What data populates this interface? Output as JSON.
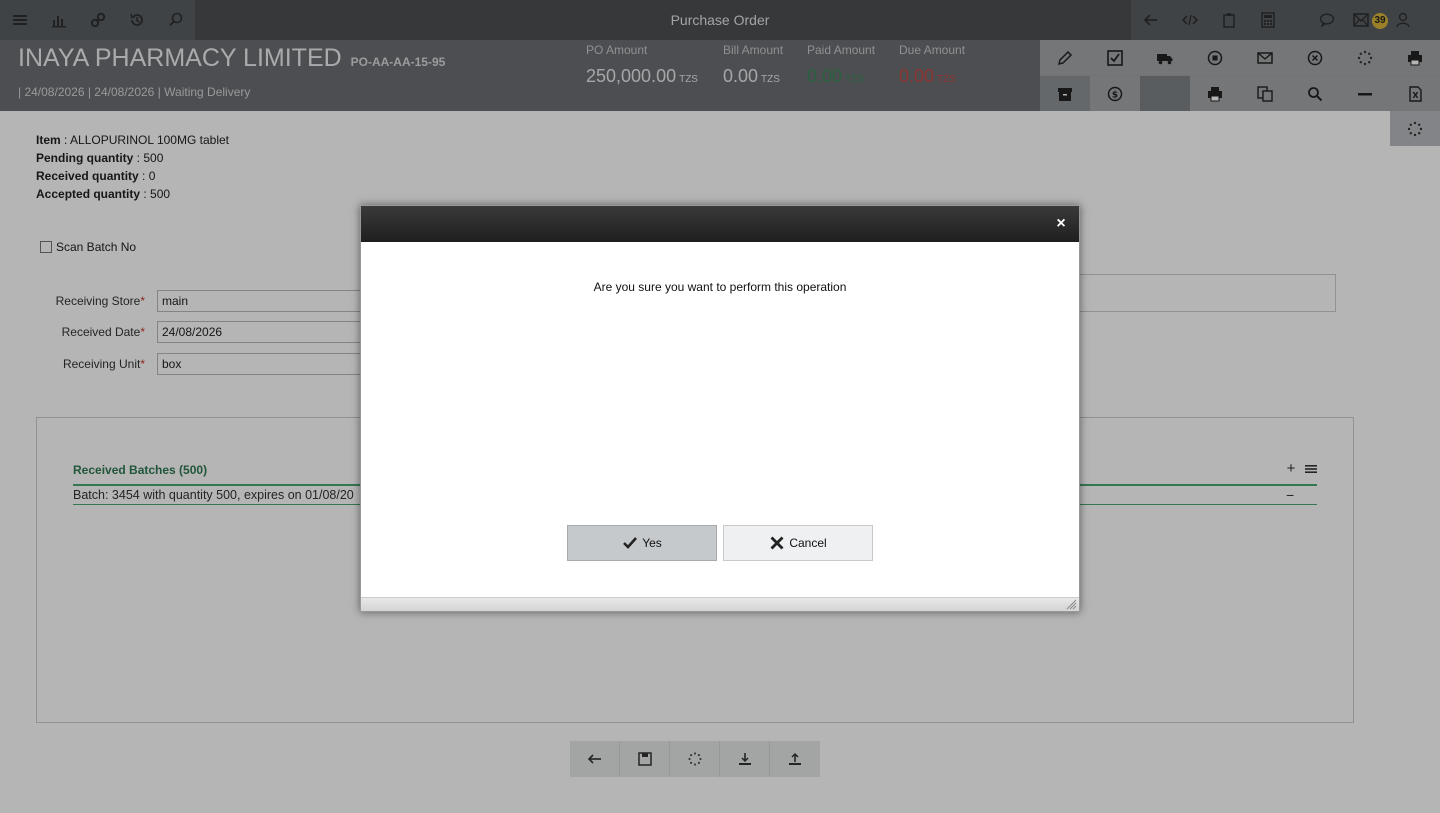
{
  "topbar": {
    "title": "Purchase Order",
    "left_icons": [
      "menu-icon",
      "bar-chart-icon",
      "link-icon",
      "history-icon",
      "search-icon"
    ],
    "right_icons": [
      "back-arrow-icon",
      "code-icon",
      "clipboard-icon",
      "calculator-icon",
      "chat-icon",
      "mail-icon",
      "user-icon"
    ],
    "mail_count": "39"
  },
  "header": {
    "company": "INAYA PHARMACY LIMITED",
    "po_code": "PO-AA-AA-15-95",
    "subinfo": "| 24/08/2026 | 24/08/2026 | Waiting Delivery",
    "amounts": {
      "po_label": "PO Amount",
      "po_value": "250,000.00",
      "po_cur": "TZS",
      "bill_label": "Bill Amount",
      "bill_value": "0.00",
      "bill_cur": "TZS",
      "paid_label": "Paid Amount",
      "paid_value": "0.00",
      "paid_cur": "TZS",
      "due_label": "Due Amount",
      "due_value": "0.00",
      "due_cur": "TZS"
    },
    "colors": {
      "paid": "#3a8a5a",
      "due": "#c84a44"
    }
  },
  "item": {
    "item_label": "Item",
    "item_value": "ALLOPURINOL 100MG tablet",
    "pending_label": "Pending quantity",
    "pending_value": "500",
    "received_label": "Received quantity",
    "received_value": "0",
    "accepted_label": "Accepted quantity",
    "accepted_value": "500"
  },
  "form": {
    "scan_label": "Scan Batch No",
    "store_label": "Receiving Store",
    "store_value": "main",
    "date_label": "Received Date",
    "date_value": "24/08/2026",
    "unit_label": "Receiving Unit",
    "unit_value": "box"
  },
  "batches": {
    "title": "Received Batches (500)",
    "row": "Batch: 3454 with quantity 500, expires on 01/08/20"
  },
  "dialog": {
    "message": "Are you sure you want to perform this operation",
    "yes_label": "Yes",
    "cancel_label": "Cancel",
    "close_glyph": "×"
  }
}
